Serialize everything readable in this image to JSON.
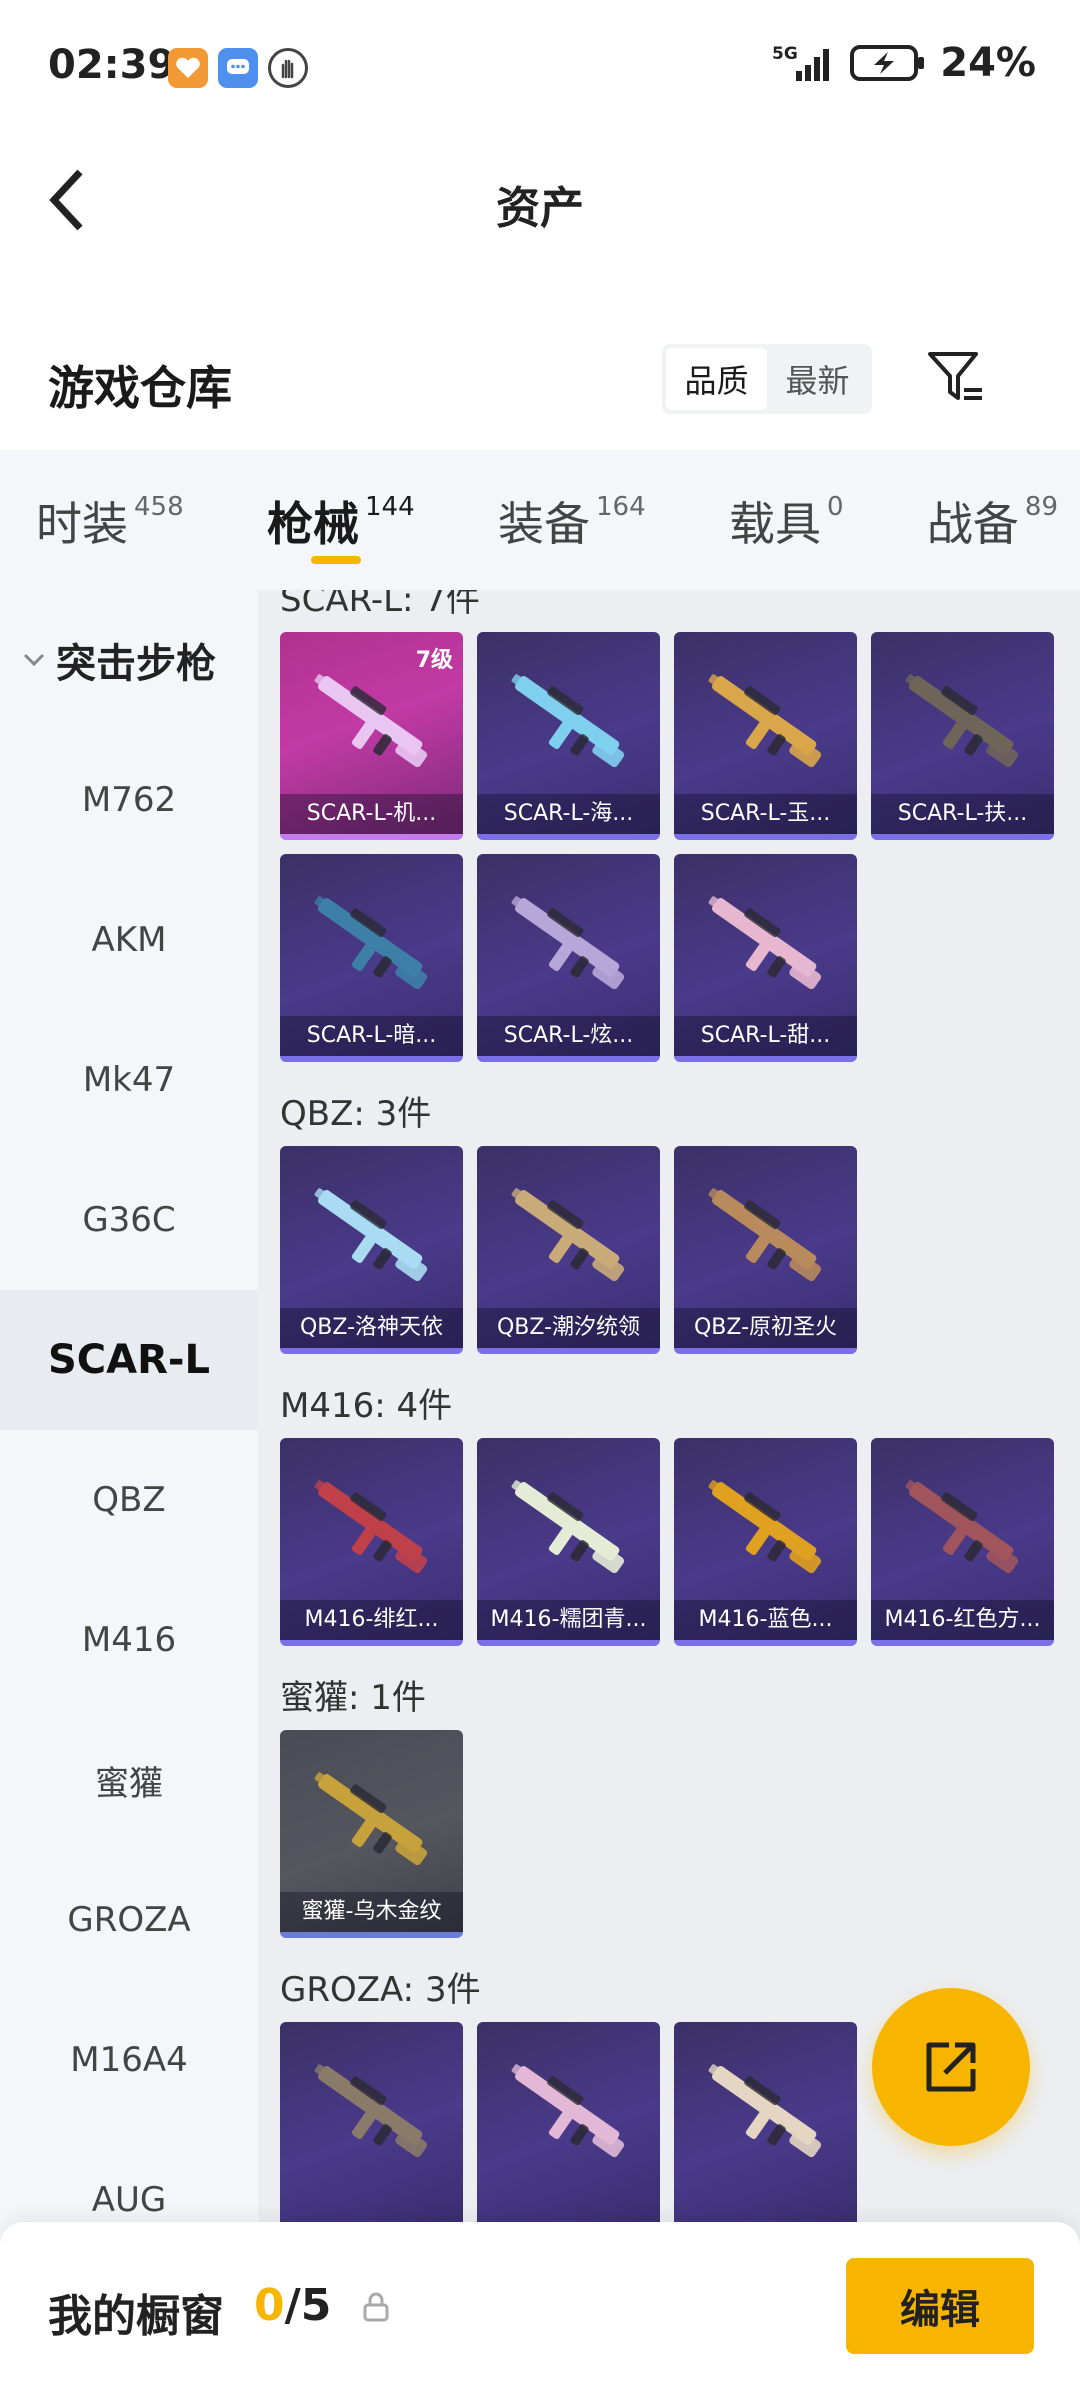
{
  "status_bar": {
    "time": "02:39",
    "network": "5G",
    "battery": "24%"
  },
  "header": {
    "title": "资产"
  },
  "section": {
    "title": "游戏仓库",
    "sort_options": [
      "品质",
      "最新"
    ],
    "active_sort": "品质"
  },
  "tabs": [
    {
      "label": "时装",
      "count": "458"
    },
    {
      "label": "枪械",
      "count": "144"
    },
    {
      "label": "装备",
      "count": "164"
    },
    {
      "label": "载具",
      "count": "0"
    },
    {
      "label": "战备",
      "count": "89"
    }
  ],
  "active_tab": "枪械",
  "sidebar": {
    "group": "突击步枪",
    "items": [
      "M762",
      "AKM",
      "Mk47",
      "G36C",
      "SCAR-L",
      "QBZ",
      "M416",
      "蜜獾",
      "GROZA",
      "M16A4",
      "AUG"
    ],
    "active": "SCAR-L"
  },
  "groups": [
    {
      "title": "SCAR-L: 7件",
      "items": [
        {
          "name": "SCAR-L-机...",
          "level": "7级",
          "style": "pink",
          "color": "#e9c6f2"
        },
        {
          "name": "SCAR-L-海...",
          "level": "",
          "style": "purple",
          "color": "#7fd0ef"
        },
        {
          "name": "SCAR-L-玉...",
          "level": "",
          "style": "purple",
          "color": "#d9a64a"
        },
        {
          "name": "SCAR-L-扶...",
          "level": "",
          "style": "purple",
          "color": "#6e6458"
        },
        {
          "name": "SCAR-L-暗...",
          "level": "",
          "style": "purple",
          "color": "#3e7fa8"
        },
        {
          "name": "SCAR-L-炫...",
          "level": "",
          "style": "purple",
          "color": "#b7a7d8"
        },
        {
          "name": "SCAR-L-甜...",
          "level": "",
          "style": "purple",
          "color": "#e6b7cf"
        }
      ]
    },
    {
      "title": "QBZ: 3件",
      "items": [
        {
          "name": "QBZ-洛神天依",
          "level": "",
          "style": "purple",
          "color": "#a9dcf2"
        },
        {
          "name": "QBZ-潮汐统领",
          "level": "",
          "style": "purple",
          "color": "#c9ab7a"
        },
        {
          "name": "QBZ-原初圣火",
          "level": "",
          "style": "purple",
          "color": "#b88a5c"
        }
      ]
    },
    {
      "title": "M416: 4件",
      "items": [
        {
          "name": "M416-绯红...",
          "level": "",
          "style": "purple",
          "color": "#c0404a"
        },
        {
          "name": "M416-糯团青...",
          "level": "",
          "style": "purple",
          "color": "#e4ecd6"
        },
        {
          "name": "M416-蓝色...",
          "level": "",
          "style": "purple",
          "color": "#e0a020"
        },
        {
          "name": "M416-红色方...",
          "level": "",
          "style": "purple",
          "color": "#a0545c"
        }
      ]
    },
    {
      "title": "蜜獾: 1件",
      "items": [
        {
          "name": "蜜獾-乌木金纹",
          "level": "",
          "style": "gray",
          "color": "#c7a13c"
        }
      ]
    },
    {
      "title": "GROZA: 3件",
      "items": [
        {
          "name": "",
          "level": "",
          "style": "purple",
          "color": "#8a7a6a"
        },
        {
          "name": "",
          "level": "",
          "style": "purple",
          "color": "#e2b8d6"
        },
        {
          "name": "",
          "level": "",
          "style": "purple",
          "color": "#e4d6c2"
        }
      ]
    }
  ],
  "bottom_bar": {
    "label": "我的橱窗",
    "current": "0",
    "total": "/5",
    "edit_label": "编辑"
  },
  "colors": {
    "accent": "#f7b500",
    "sidebar_bg": "#f4f6fa",
    "content_bg": "#eceef2"
  }
}
